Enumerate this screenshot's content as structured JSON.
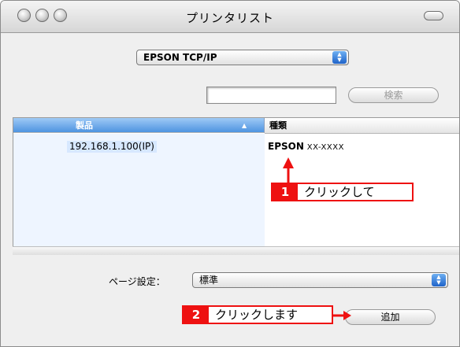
{
  "window": {
    "title": "プリンタリスト"
  },
  "protocol_select": {
    "value": "EPSON TCP/IP"
  },
  "search": {
    "value": "",
    "button_label": "検索"
  },
  "printer_list": {
    "columns": {
      "product": "製品",
      "kind": "種類"
    },
    "rows": [
      {
        "product": "192.168.1.100(IP)",
        "kind_brand": "EPSON",
        "kind_model": "XX-XXXX"
      }
    ]
  },
  "page_setup": {
    "label": "ページ設定：",
    "value": "標準"
  },
  "add_button": {
    "label": "追加"
  },
  "callouts": [
    {
      "number": "1",
      "text": "クリックして"
    },
    {
      "number": "2",
      "text": "クリックします"
    }
  ],
  "colors": {
    "callout": "#ee1111",
    "selection": "#4e93e0"
  },
  "icons": {
    "traffic_lights": "window-control-buttons",
    "toolbar_toggle": "toolbar-pill-icon",
    "popup_arrows": "up-down-arrows-icon",
    "sort": "sort-up-triangle-icon"
  }
}
